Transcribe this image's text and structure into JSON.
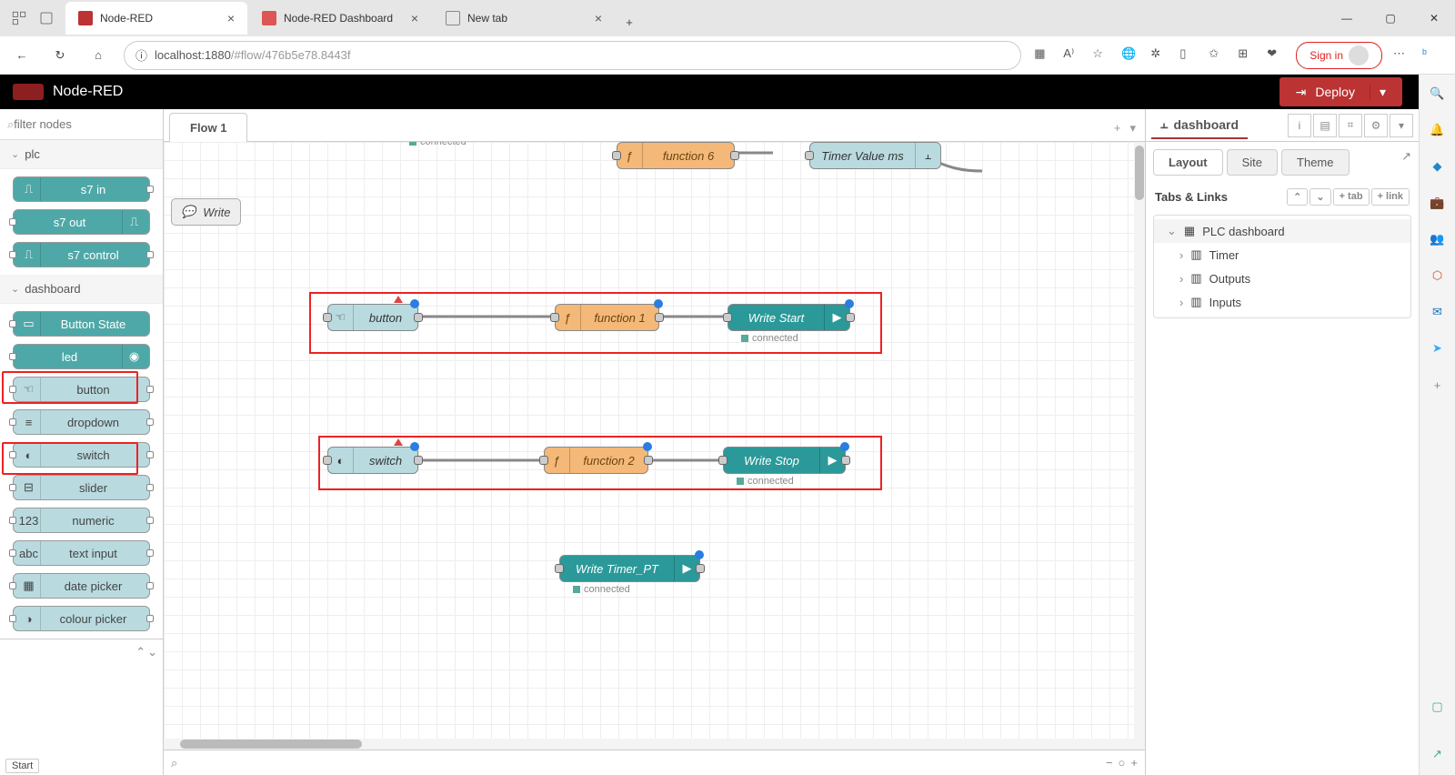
{
  "browser": {
    "tabs": [
      {
        "title": "Node-RED",
        "active": true
      },
      {
        "title": "Node-RED Dashboard",
        "active": false
      },
      {
        "title": "New tab",
        "active": false
      }
    ],
    "url_host": "localhost",
    "url_port": ":1880",
    "url_path": "/#flow/476b5e78.8443f",
    "signin": "Sign in"
  },
  "header": {
    "title": "Node-RED",
    "deploy": "Deploy"
  },
  "palette": {
    "filter_placeholder": "filter nodes",
    "cat_plc": "plc",
    "cat_dashboard": "dashboard",
    "plc": [
      "s7 in",
      "s7 out",
      "s7 control"
    ],
    "dashboard": [
      "Button State",
      "led",
      "button",
      "dropdown",
      "switch",
      "slider",
      "numeric",
      "text input",
      "date picker",
      "colour picker"
    ]
  },
  "ws": {
    "tab": "Flow 1",
    "comment_write": "Write",
    "nodes": {
      "fn6": "function 6",
      "timer_value": "Timer Value ms",
      "button": "button",
      "fn1": "function 1",
      "write_start": "Write Start",
      "switch": "switch",
      "fn2": "function 2",
      "write_stop": "Write Stop",
      "write_timer_pt": "Write Timer_PT",
      "connected": "connected"
    }
  },
  "sidebar": {
    "title": "dashboard",
    "tabs_layout": "Layout",
    "tabs_site": "Site",
    "tabs_theme": "Theme",
    "section": "Tabs & Links",
    "btn_tab": "+ tab",
    "btn_link": "+ link",
    "tree": {
      "root": "PLC dashboard",
      "items": [
        "Timer",
        "Outputs",
        "Inputs"
      ]
    }
  },
  "footer": {
    "start": "Start"
  }
}
